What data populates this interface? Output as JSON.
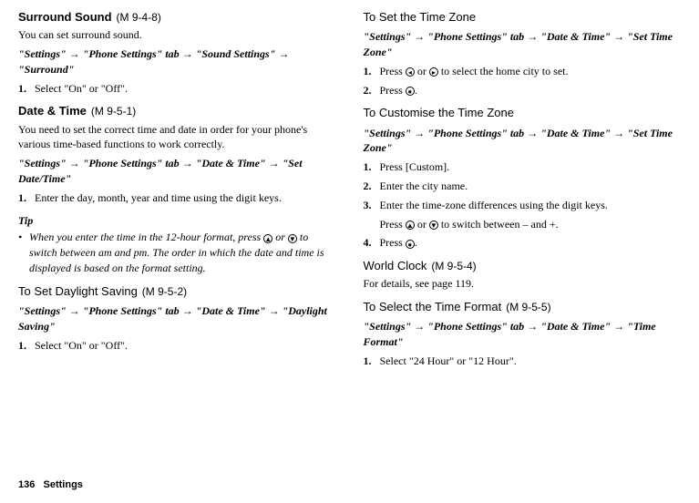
{
  "col1": {
    "surround": {
      "title": "Surround Sound",
      "mcode": "(M 9-4-8)",
      "intro": "You can set surround sound.",
      "path": {
        "p1": "\"Settings\"",
        "p2": "\"Phone Settings\" tab",
        "p3": "\"Sound Settings\"",
        "p4": "\"Surround\""
      },
      "step1": "Select \"On\" or \"Off\"."
    },
    "datetime": {
      "title": "Date & Time",
      "mcode": "(M 9-5-1)",
      "intro": "You need to set the correct time and date in order for your phone's various time-based functions to work correctly.",
      "path": {
        "p1": "\"Settings\"",
        "p2": "\"Phone Settings\" tab",
        "p3": "\"Date & Time\"",
        "p4": "\"Set Date/Time\""
      },
      "step1": "Enter the day, month, year and time using the digit keys."
    },
    "tip": {
      "title": "Tip",
      "text_a": "When you enter the time in the 12-hour format, press ",
      "text_b": " or ",
      "text_c": " to switch between am and pm. The order in which the date and time is displayed is based on the format setting."
    },
    "daylight": {
      "title": "To Set Daylight Saving",
      "mcode": "(M 9-5-2)",
      "path": {
        "p1": "\"Settings\"",
        "p2": "\"Phone Settings\" tab",
        "p3": "\"Date & Time\"",
        "p4": "\"Daylight Saving\""
      },
      "step1": "Select \"On\" or \"Off\"."
    }
  },
  "col2": {
    "timezone": {
      "title": "To Set the Time Zone",
      "path": {
        "p1": "\"Settings\"",
        "p2": "\"Phone Settings\" tab",
        "p3": "\"Date & Time\"",
        "p4": "\"Set Time Zone\""
      },
      "step1a": "Press ",
      "step1b": " or ",
      "step1c": " to select the home city to set.",
      "step2a": "Press ",
      "step2b": "."
    },
    "customtz": {
      "title": "To Customise the Time Zone",
      "path": {
        "p1": "\"Settings\"",
        "p2": "\"Phone Settings\" tab",
        "p3": "\"Date & Time\"",
        "p4": "\"Set Time Zone\""
      },
      "step1": "Press [Custom].",
      "step2": "Enter the city name.",
      "step3": "Enter the time-zone differences using the digit keys.",
      "step3b_a": "Press ",
      "step3b_b": " or ",
      "step3b_c": " to switch between – and +.",
      "step4a": "Press ",
      "step4b": "."
    },
    "worldclock": {
      "title": "World Clock",
      "mcode": "(M 9-5-4)",
      "text": "For details, see page 119."
    },
    "timeformat": {
      "title": "To Select the Time Format",
      "mcode": "(M 9-5-5)",
      "path": {
        "p1": "\"Settings\"",
        "p2": "\"Phone Settings\" tab",
        "p3": "\"Date & Time\"",
        "p4": "\"Time Format\""
      },
      "step1": "Select \"24 Hour\" or \"12 Hour\"."
    }
  },
  "footer": {
    "pagenum": "136",
    "section": "Settings"
  },
  "icons": {
    "up": "▲",
    "down": "▼",
    "left": "◂",
    "right": "▸",
    "center": "●"
  }
}
